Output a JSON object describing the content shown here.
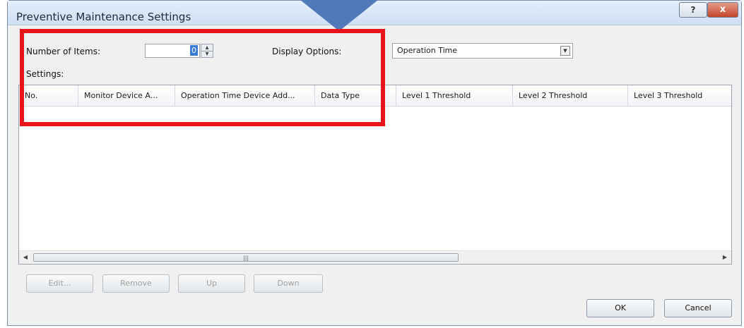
{
  "window": {
    "title": "Preventive Maintenance Settings",
    "help_label": "?",
    "close_label": "x"
  },
  "form": {
    "num_items_label": "Number of Items:",
    "num_items_value": "0",
    "display_options_label": "Display Options:",
    "display_options_value": "Operation Time",
    "settings_label": "Settings:"
  },
  "table": {
    "columns": [
      "No.",
      "Monitor Device A...",
      "Operation Time Device Add...",
      "Data Type",
      "Level 1 Threshold",
      "Level 2 Threshold",
      "Level 3 Threshold"
    ],
    "rows": []
  },
  "buttons": {
    "edit": "Edit...",
    "remove": "Remove",
    "up": "Up",
    "down": "Down",
    "ok": "OK",
    "cancel": "Cancel"
  },
  "colors": {
    "highlight": "#e8131b",
    "pointer": "#4f79b9"
  },
  "icons": {
    "spin_up": "up-arrow",
    "spin_down": "down-arrow",
    "dropdown": "chevron-down",
    "scroll_left": "left-arrow",
    "scroll_right": "right-arrow"
  }
}
